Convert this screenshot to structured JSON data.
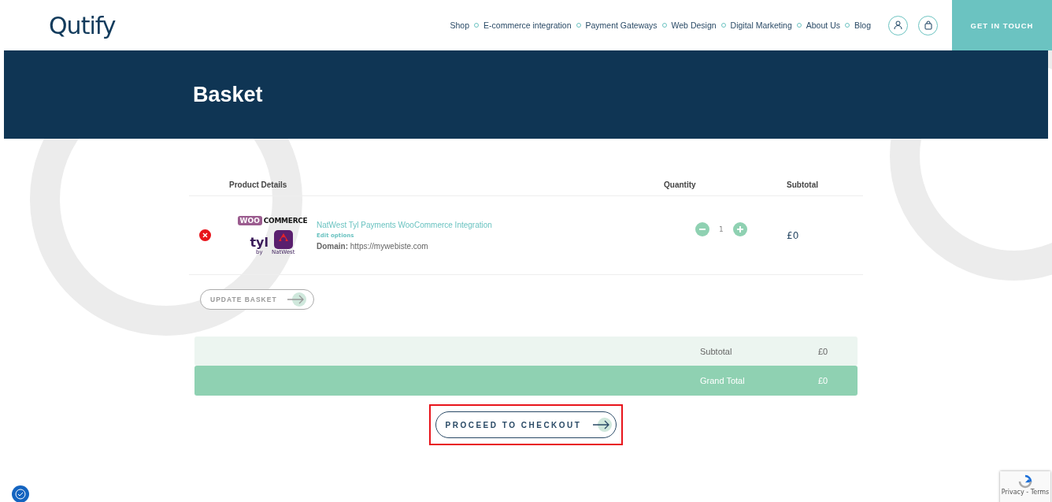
{
  "header": {
    "logo": "Qutify",
    "nav": [
      {
        "label": "Shop",
        "dropdown": true
      },
      {
        "label": "E-commerce integration",
        "dropdown": true
      },
      {
        "label": "Payment Gateways",
        "dropdown": true
      },
      {
        "label": "Web Design",
        "dropdown": true
      },
      {
        "label": "Digital Marketing",
        "dropdown": true
      },
      {
        "label": "About Us",
        "dropdown": true
      },
      {
        "label": "Blog",
        "dropdown": false
      }
    ],
    "cta": "GET IN TOUCH"
  },
  "banner": {
    "title": "Basket"
  },
  "table": {
    "columns": [
      "Product Details",
      "Quantity",
      "Subtotal"
    ],
    "rows": [
      {
        "logo_brand": "WOO",
        "logo_word": "COMMERCE",
        "logo_tyl": "tyl",
        "logo_by": "by",
        "logo_bank": "NatWest",
        "name": "NatWest Tyl Payments WooCommerce Integration",
        "edit": "Edit options",
        "domain_label": "Domain:",
        "domain": "https://mywebiste.com",
        "quantity": "1",
        "subtotal": "£0"
      }
    ]
  },
  "update_button": "UPDATE BASKET",
  "totals": [
    {
      "label": "Subtotal",
      "value": "£0",
      "kind": "plain"
    },
    {
      "label": "Grand Total",
      "value": "£0",
      "kind": "grand"
    }
  ],
  "checkout_button": {
    "label": "PROCEED TO CHECKOUT",
    "highlighted": true
  },
  "recaptcha": "Privacy - Terms"
}
